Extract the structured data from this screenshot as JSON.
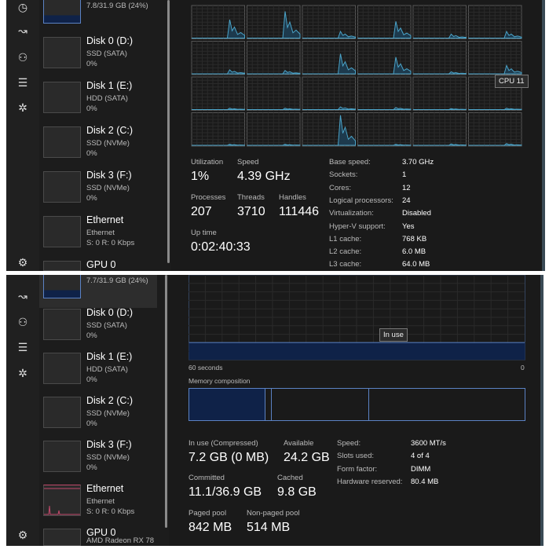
{
  "cpu_view": {
    "sidebar": [
      {
        "title": "",
        "sub1": "7.8/31.9 GB (24%)",
        "sub2": ""
      },
      {
        "title": "Disk 0 (D:)",
        "sub1": "SSD (SATA)",
        "sub2": "0%"
      },
      {
        "title": "Disk 1 (E:)",
        "sub1": "HDD (SATA)",
        "sub2": "0%"
      },
      {
        "title": "Disk 2 (C:)",
        "sub1": "SSD (NVMe)",
        "sub2": "0%"
      },
      {
        "title": "Disk 3 (F:)",
        "sub1": "SSD (NVMe)",
        "sub2": "0%"
      },
      {
        "title": "Ethernet",
        "sub1": "Ethernet",
        "sub2": "S: 0 R: 0 Kbps"
      },
      {
        "title": "GPU 0",
        "sub1": "",
        "sub2": ""
      }
    ],
    "tooltip": "CPU 11",
    "core_peaks": [
      55,
      80,
      20,
      50,
      12,
      20,
      12,
      10,
      60,
      50,
      6,
      25,
      4,
      4,
      8,
      6,
      3,
      4,
      3,
      3,
      90,
      3,
      4,
      5
    ],
    "stats": {
      "utilization_label": "Utilization",
      "utilization": "1%",
      "speed_label": "Speed",
      "speed": "4.39 GHz",
      "processes_label": "Processes",
      "processes": "207",
      "threads_label": "Threads",
      "threads": "3710",
      "handles_label": "Handles",
      "handles": "111446",
      "uptime_label": "Up time",
      "uptime": "0:02:40:33"
    },
    "specs": [
      {
        "k": "Base speed:",
        "v": "3.70 GHz"
      },
      {
        "k": "Sockets:",
        "v": "1"
      },
      {
        "k": "Cores:",
        "v": "12"
      },
      {
        "k": "Logical processors:",
        "v": "24"
      },
      {
        "k": "Virtualization:",
        "v": "Disabled"
      },
      {
        "k": "Hyper-V support:",
        "v": "Yes"
      },
      {
        "k": "L1 cache:",
        "v": "768 KB"
      },
      {
        "k": "L2 cache:",
        "v": "6.0 MB"
      },
      {
        "k": "L3 cache:",
        "v": "64.0 MB"
      }
    ]
  },
  "memory_view": {
    "sidebar": [
      {
        "title": "",
        "sub1": "7.7/31.9 GB (24%)",
        "sub2": ""
      },
      {
        "title": "Disk 0 (D:)",
        "sub1": "SSD (SATA)",
        "sub2": "0%"
      },
      {
        "title": "Disk 1 (E:)",
        "sub1": "HDD (SATA)",
        "sub2": "0%"
      },
      {
        "title": "Disk 2 (C:)",
        "sub1": "SSD (NVMe)",
        "sub2": "0%"
      },
      {
        "title": "Disk 3 (F:)",
        "sub1": "SSD (NVMe)",
        "sub2": "0%"
      },
      {
        "title": "Ethernet",
        "sub1": "Ethernet",
        "sub2": "S: 0 R: 0 Kbps"
      },
      {
        "title": "GPU 0",
        "sub1": "AMD Radeon RX 78",
        "sub2": ""
      }
    ],
    "graph": {
      "tooltip": "In use",
      "x_left": "60 seconds",
      "x_right": "0",
      "in_use_fraction": 0.24
    },
    "composition_label": "Memory composition",
    "stats": {
      "in_use_label": "In use (Compressed)",
      "in_use": "7.2 GB (0 MB)",
      "available_label": "Available",
      "available": "24.2 GB",
      "committed_label": "Committed",
      "committed": "11.1/36.9 GB",
      "cached_label": "Cached",
      "cached": "9.8 GB",
      "paged_label": "Paged pool",
      "paged": "842 MB",
      "nonpaged_label": "Non-paged pool",
      "nonpaged": "514 MB"
    },
    "specs": [
      {
        "k": "Speed:",
        "v": "3600 MT/s"
      },
      {
        "k": "Slots used:",
        "v": "4 of 4"
      },
      {
        "k": "Form factor:",
        "v": "DIMM"
      },
      {
        "k": "Hardware reserved:",
        "v": "80.4 MB"
      }
    ]
  },
  "colors": {
    "cpu_line": "#4aa3c8",
    "mem_fill": "#0f2248",
    "mem_line": "#5b82c4",
    "eth_line": "#c0486a"
  }
}
